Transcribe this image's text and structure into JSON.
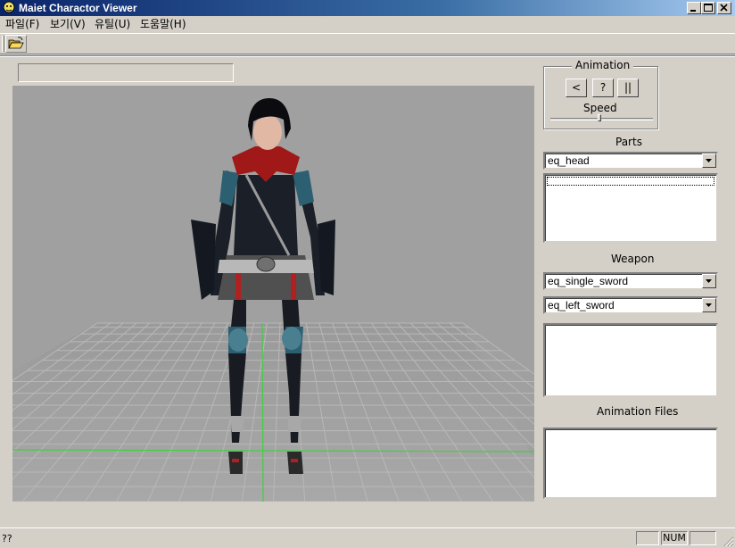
{
  "window": {
    "title": "Maiet Charactor Viewer"
  },
  "menu": {
    "items": [
      "파일(F)",
      "보기(V)",
      "유틸(U)",
      "도움말(H)"
    ]
  },
  "toolbar": {
    "open_icon": "folder-open-icon"
  },
  "animation": {
    "group_label": "Animation",
    "prev_label": "<",
    "help_label": "?",
    "pause_label": "||",
    "speed_label": "Speed",
    "speed_value": 0.48
  },
  "parts": {
    "label": "Parts",
    "selected": "eq_head"
  },
  "weapon": {
    "label": "Weapon",
    "right_selected": "eq_single_sword",
    "left_selected": "eq_left_sword"
  },
  "animation_files": {
    "label": "Animation Files"
  },
  "status": {
    "text": "??",
    "num": "NUM"
  },
  "colors": {
    "titlebar_start": "#0a246a",
    "titlebar_end": "#a6caf0",
    "viewport_bg": "#a0a0a0",
    "grid_axis": "#40d040",
    "face": "#d4d0c8"
  }
}
